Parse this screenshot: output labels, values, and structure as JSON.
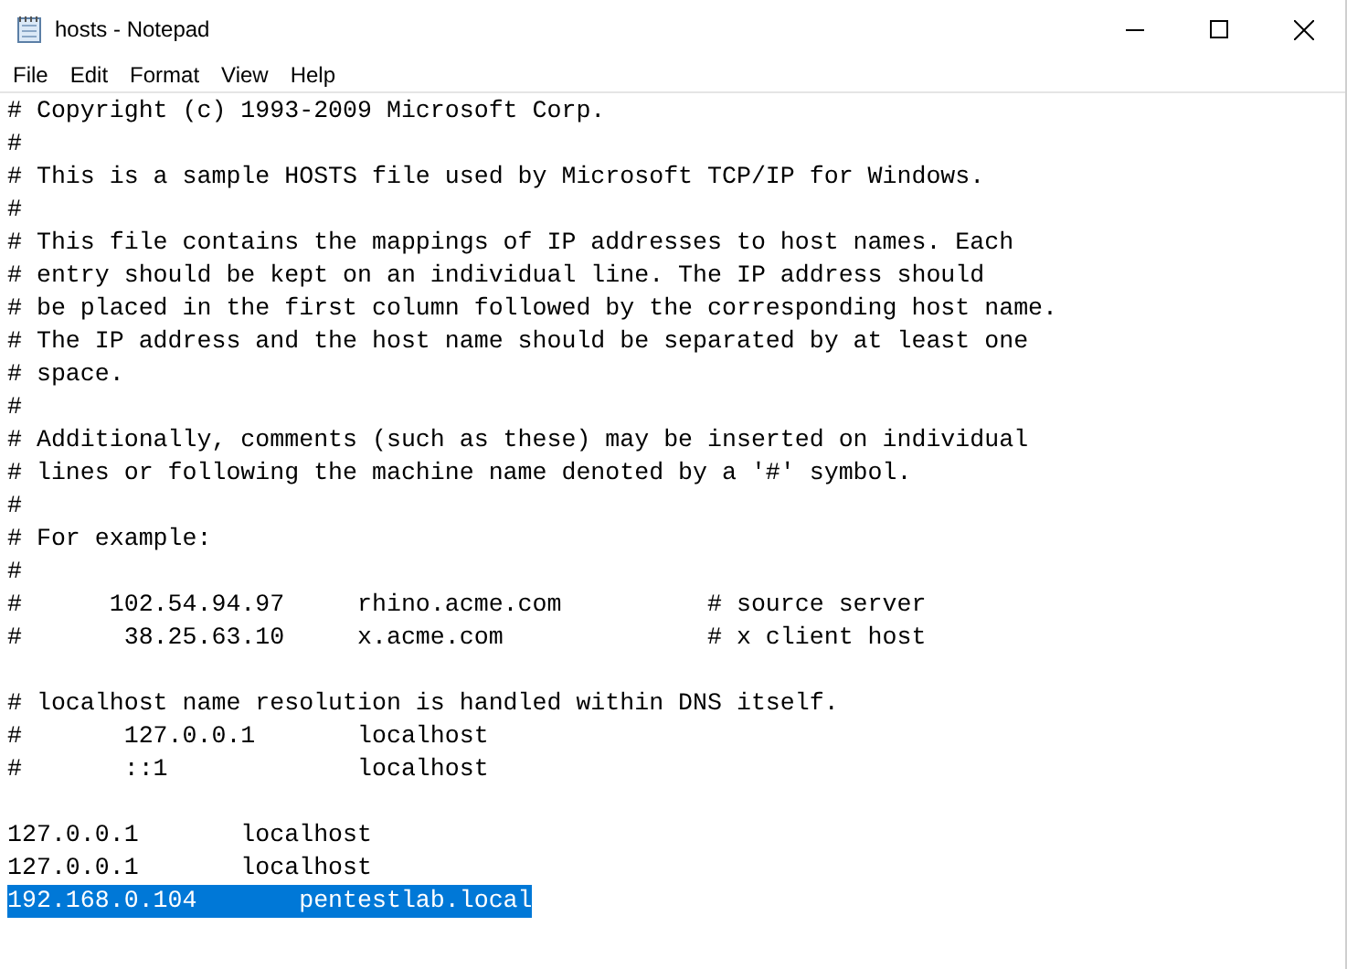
{
  "window": {
    "title": "hosts - Notepad"
  },
  "menu": [
    {
      "label": "File"
    },
    {
      "label": "Edit"
    },
    {
      "label": "Format"
    },
    {
      "label": "View"
    },
    {
      "label": "Help"
    }
  ],
  "lines": [
    {
      "kind": "text",
      "text": "# Copyright (c) 1993-2009 Microsoft Corp.",
      "selected": false
    },
    {
      "kind": "text",
      "text": "#",
      "selected": false
    },
    {
      "kind": "text",
      "text": "# This is a sample HOSTS file used by Microsoft TCP/IP for Windows.",
      "selected": false
    },
    {
      "kind": "text",
      "text": "#",
      "selected": false
    },
    {
      "kind": "text",
      "text": "# This file contains the mappings of IP addresses to host names. Each",
      "selected": false
    },
    {
      "kind": "text",
      "text": "# entry should be kept on an individual line. The IP address should",
      "selected": false
    },
    {
      "kind": "text",
      "text": "# be placed in the first column followed by the corresponding host name.",
      "selected": false
    },
    {
      "kind": "text",
      "text": "# The IP address and the host name should be separated by at least one",
      "selected": false
    },
    {
      "kind": "text",
      "text": "# space.",
      "selected": false
    },
    {
      "kind": "text",
      "text": "#",
      "selected": false
    },
    {
      "kind": "text",
      "text": "# Additionally, comments (such as these) may be inserted on individual",
      "selected": false
    },
    {
      "kind": "text",
      "text": "# lines or following the machine name denoted by a '#' symbol.",
      "selected": false
    },
    {
      "kind": "text",
      "text": "#",
      "selected": false
    },
    {
      "kind": "text",
      "text": "# For example:",
      "selected": false
    },
    {
      "kind": "text",
      "text": "#",
      "selected": false
    },
    {
      "kind": "text",
      "text": "#      102.54.94.97     rhino.acme.com          # source server",
      "selected": false
    },
    {
      "kind": "text",
      "text": "#       38.25.63.10     x.acme.com              # x client host",
      "selected": false
    },
    {
      "kind": "blank",
      "selected": false
    },
    {
      "kind": "text",
      "text": "# localhost name resolution is handled within DNS itself.",
      "selected": false
    },
    {
      "kind": "text",
      "text": "#       127.0.0.1       localhost",
      "selected": false
    },
    {
      "kind": "text",
      "text": "#       ::1             localhost",
      "selected": false
    },
    {
      "kind": "blank",
      "selected": false
    },
    {
      "kind": "text",
      "text": "127.0.0.1       localhost",
      "selected": false
    },
    {
      "kind": "text",
      "text": "127.0.0.1       localhost",
      "selected": false
    },
    {
      "kind": "text",
      "text": "192.168.0.104       pentestlab.local",
      "selected": true
    }
  ]
}
